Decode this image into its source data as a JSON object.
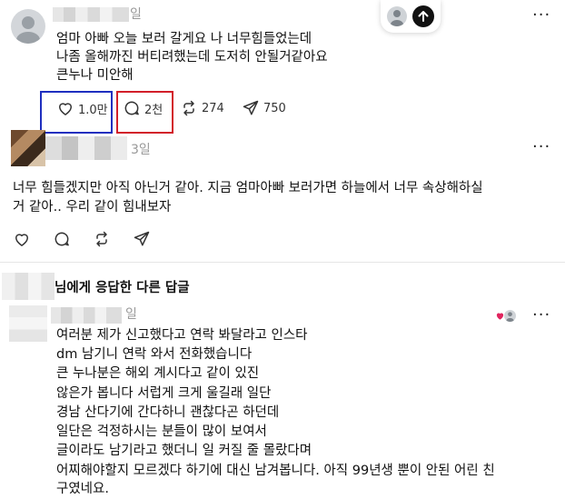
{
  "post1": {
    "time": "일",
    "lines": [
      "엄마 아빠 오늘 보러 갈게요 나 너무힘들었는데",
      "나좀 올해까진 버티려했는데 도저히 안될거같아요",
      "큰누나 미안해"
    ],
    "likes": "1.0만",
    "replies": "2천",
    "reposts": "274",
    "shares": "750"
  },
  "post2": {
    "time": "3일",
    "lines": [
      "너무 힘들겠지만 아직 아닌거 같아. 지금 엄마아빠 보러가면 하늘에서 너무 속상해하실",
      "거 같아.. 우리 같이 힘내보자"
    ]
  },
  "section": {
    "header": "님에게 응답한 다른 답글"
  },
  "post3": {
    "time": "일",
    "lines": [
      "여러분 제가 신고했다고 연락 봐달라고 인스타",
      "dm 남기니 연락 와서 전화했습니다",
      "큰 누나분은 해외 계시다고 같이 있진",
      "않은가 봅니다 서럽게 크게 울길래 일단",
      "경남 산다기에 간다하니 괜찮다곤 하던데",
      "일단은 걱정하시는 분들이 많이 보여서",
      "글이라도 남기라고 했더니 일 커질 줄 몰랐다며",
      "어찌해야할지 모르겠다 하기에 대신 남겨봅니다. 아직 99년생 뿐이 안된 어린 친",
      "구였네요."
    ]
  },
  "colors": {
    "highlight_blue": "#1f2fbf",
    "highlight_red": "#d21f2a",
    "heart_red": "#e0245e"
  },
  "icons": [
    "user-icon",
    "arrow-up-icon",
    "more-icon",
    "heart-icon",
    "comment-icon",
    "repost-icon",
    "share-icon"
  ]
}
